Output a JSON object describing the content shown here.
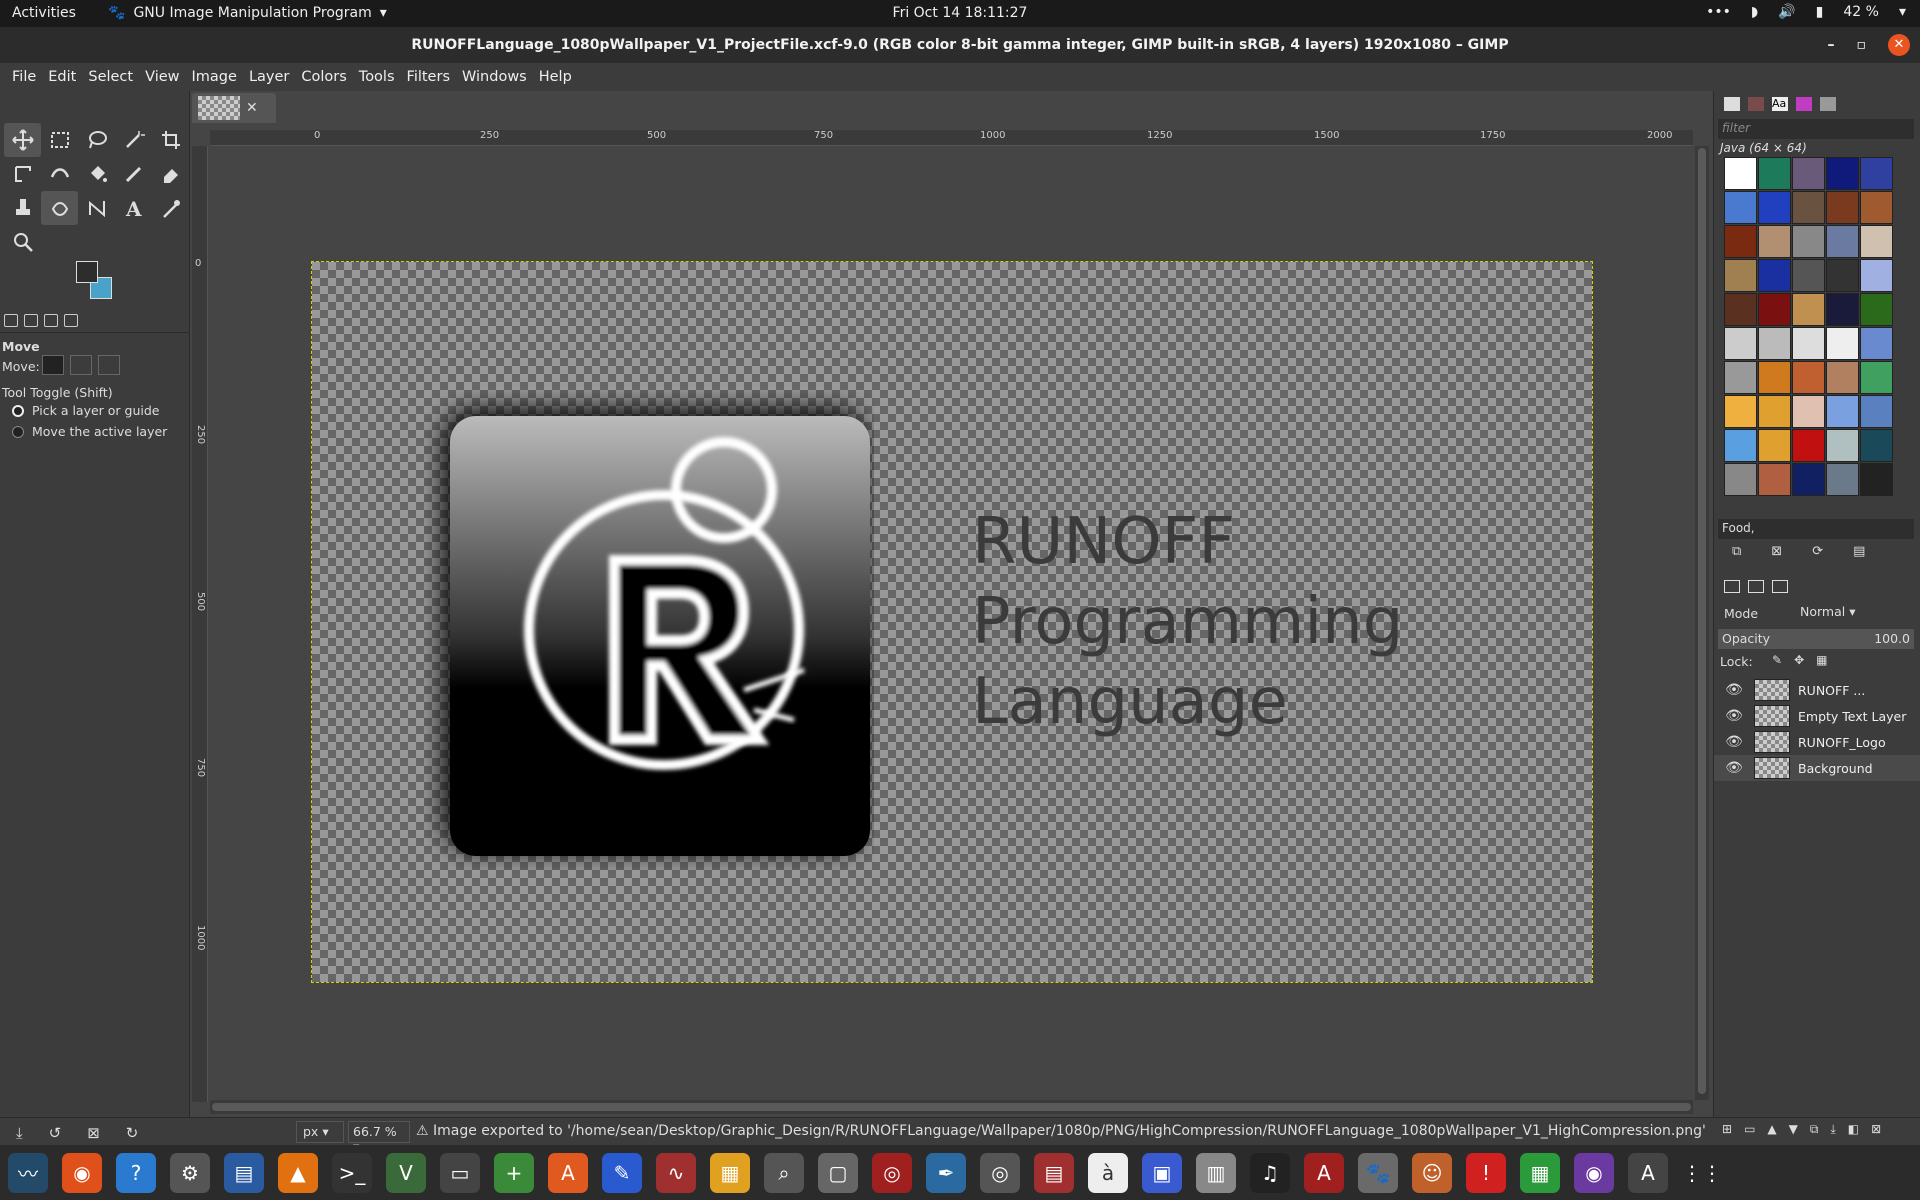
{
  "topbar": {
    "activities": "Activities",
    "app_name": "GNU Image Manipulation Program",
    "clock": "Fri Oct 14  18:11:27",
    "battery": "42 %"
  },
  "window": {
    "title": "RUNOFFLanguage_1080pWallpaper_V1_ProjectFile.xcf-9.0 (RGB color 8-bit gamma integer, GIMP built-in sRGB, 4 layers) 1920x1080 – GIMP"
  },
  "menu": [
    "File",
    "Edit",
    "Select",
    "View",
    "Image",
    "Layer",
    "Colors",
    "Tools",
    "Filters",
    "Windows",
    "Help"
  ],
  "tool_options": {
    "title": "Move",
    "move_label": "Move:",
    "toggle_label": "Tool Toggle  (Shift)",
    "opt1": "Pick a layer or guide",
    "opt2": "Move the active layer"
  },
  "ruler": {
    "h": [
      "0",
      "250",
      "500",
      "750",
      "1000",
      "1250",
      "1500",
      "1750",
      "2000"
    ],
    "v": [
      "0",
      "250",
      "500",
      "750",
      "1000"
    ]
  },
  "canvas": {
    "line1": "RUNOFF",
    "line2": "Programming",
    "line3": "Language"
  },
  "statusbar": {
    "unit": "px",
    "zoom": "66.7 %",
    "message": "Image exported to '/home/sean/Desktop/Graphic_Design/R/RUNOFFLanguage/Wallpaper/1080p/PNG/HighCompression/RUNOFFLanguage_1080pWallpaper_V1_HighCompression.png'"
  },
  "patterns": {
    "filter_placeholder": "filter",
    "current": "Java (64 × 64)",
    "tag": "Food,"
  },
  "layers_panel": {
    "mode_label": "Mode",
    "mode_value": "Normal",
    "opacity_label": "Opacity",
    "opacity_value": "100.0",
    "lock_label": "Lock:"
  },
  "layers": [
    {
      "name": "RUNOFF ..."
    },
    {
      "name": "Empty Text Layer"
    },
    {
      "name": "RUNOFF_Logo"
    },
    {
      "name": "Background"
    }
  ],
  "colors": {
    "fg": "#2d2d2d",
    "bg": "#49a3c9"
  }
}
